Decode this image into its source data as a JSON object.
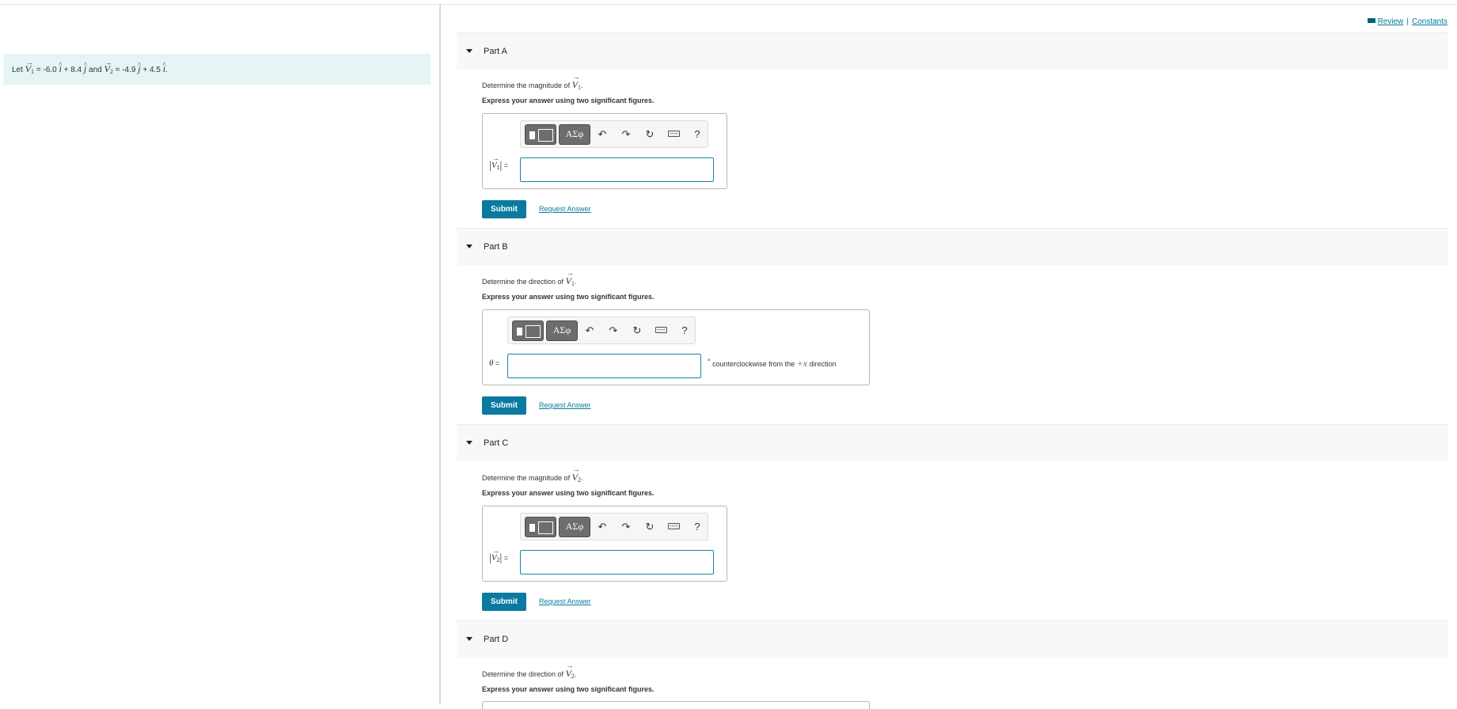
{
  "intro": {
    "let": "Let",
    "v1": "V",
    "v1_sub": "1",
    "v1_expr_a": "= -6.0",
    "i": "i",
    "v1_expr_b": "+ 8.4",
    "j": "j",
    "and": "and",
    "v2": "V",
    "v2_sub": "2",
    "v2_expr_a": "= -4.9",
    "v2_expr_b": "+ 4.5",
    "period": "."
  },
  "links": {
    "review": "Review",
    "separator": "|",
    "constants": "Constants"
  },
  "toolbar": {
    "greek": "ΑΣφ",
    "undo": "↶",
    "redo": "↷",
    "reset": "↻",
    "help": "?"
  },
  "common": {
    "instruction": "Express your answer using two significant figures.",
    "submit": "Submit",
    "request": "Request Answer",
    "equals": "=",
    "abs_bar": "|"
  },
  "parts": {
    "a": {
      "label": "Part A",
      "question": "Determine the magnitude of",
      "sym": "V",
      "sub": "1",
      "field_sym": "V",
      "field_sub": "1"
    },
    "b": {
      "label": "Part B",
      "question": "Determine the direction of",
      "sym": "V",
      "sub": "1",
      "field_sym": "θ",
      "unit_deg": "°",
      "unit_text_a": "counterclockwise from the",
      "unit_math": "+x",
      "unit_text_b": "direction"
    },
    "c": {
      "label": "Part C",
      "question": "Determine the magnitude of",
      "sym": "V",
      "sub": "2",
      "field_sym": "V",
      "field_sub": "2"
    },
    "d": {
      "label": "Part D",
      "question": "Determine the direction of",
      "sym": "V",
      "sub": "2"
    }
  }
}
